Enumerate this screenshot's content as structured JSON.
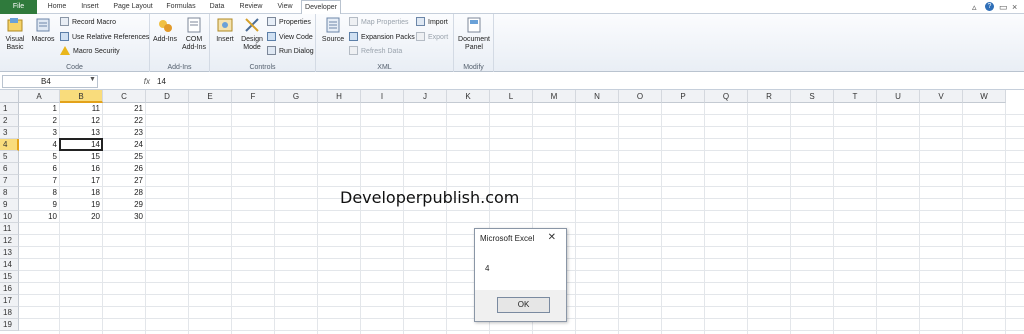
{
  "tabs": [
    "File",
    "Home",
    "Insert",
    "Page Layout",
    "Formulas",
    "Data",
    "Review",
    "View",
    "Developer"
  ],
  "window_controls": {
    "minimize": "▵",
    "help": "?",
    "restore": "▭",
    "close": "×"
  },
  "ribbon": {
    "code": {
      "label": "Code",
      "visual_basic": "Visual Basic",
      "macros": "Macros",
      "record_macro": "Record Macro",
      "use_relative": "Use Relative References",
      "macro_security": "Macro Security"
    },
    "addins": {
      "label": "Add-Ins",
      "addins": "Add-Ins",
      "com_addins": "COM Add-Ins"
    },
    "controls": {
      "label": "Controls",
      "insert": "Insert",
      "design_mode": "Design Mode",
      "properties": "Properties",
      "view_code": "View Code",
      "run_dialog": "Run Dialog"
    },
    "xml": {
      "label": "XML",
      "source": "Source",
      "map_properties": "Map Properties",
      "expansion_packs": "Expansion Packs",
      "refresh_data": "Refresh Data",
      "import": "Import",
      "export": "Export"
    },
    "modify": {
      "label": "Modify",
      "document_panel": "Document Panel"
    }
  },
  "formula_bar": {
    "name_box": "B4",
    "fx": "fx",
    "value": "14"
  },
  "columns": [
    "A",
    "B",
    "C",
    "D",
    "E",
    "F",
    "G",
    "H",
    "I",
    "J",
    "K",
    "L",
    "M",
    "N",
    "O",
    "P",
    "Q",
    "R",
    "S",
    "T",
    "U",
    "V",
    "W"
  ],
  "rows": [
    "1",
    "2",
    "3",
    "4",
    "5",
    "6",
    "7",
    "8",
    "9",
    "10",
    "11",
    "12",
    "13",
    "14",
    "15",
    "16",
    "17",
    "18",
    "19"
  ],
  "cells": {
    "A": [
      "1",
      "2",
      "3",
      "4",
      "5",
      "6",
      "7",
      "8",
      "9",
      "10"
    ],
    "B": [
      "11",
      "12",
      "13",
      "14",
      "15",
      "16",
      "17",
      "18",
      "19",
      "20"
    ],
    "C": [
      "21",
      "22",
      "23",
      "24",
      "25",
      "26",
      "27",
      "28",
      "29",
      "30"
    ]
  },
  "watermark": "Developerpublish.com",
  "dialog": {
    "title": "Microsoft Excel",
    "close": "✕",
    "message": "4",
    "ok": "OK"
  }
}
